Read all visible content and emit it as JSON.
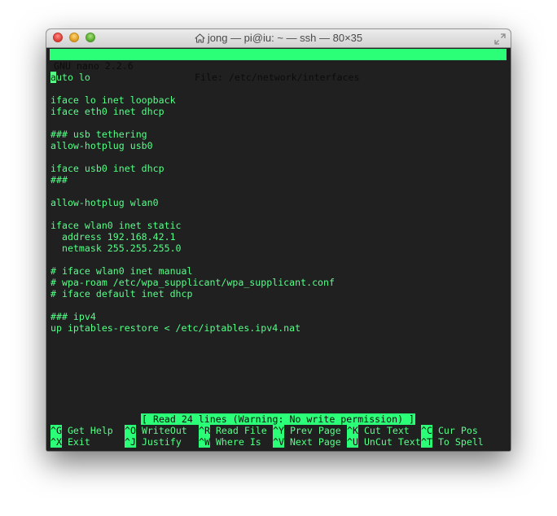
{
  "window": {
    "title": "jong — pi@iu: ~ — ssh — 80×35"
  },
  "nano": {
    "version": "GNU nano 2.2.6",
    "file": "File: /etc/network/interfaces",
    "cursor_char": "a",
    "first_line_rest": "uto lo",
    "lines": [
      "",
      "iface lo inet loopback",
      "iface eth0 inet dhcp",
      "",
      "### usb tethering",
      "allow-hotplug usb0",
      "",
      "iface usb0 inet dhcp",
      "###",
      "",
      "allow-hotplug wlan0",
      "",
      "iface wlan0 inet static",
      "  address 192.168.42.1",
      "  netmask 255.255.255.0",
      "",
      "# iface wlan0 inet manual",
      "# wpa-roam /etc/wpa_supplicant/wpa_supplicant.conf",
      "# iface default inet dhcp",
      "",
      "### ipv4",
      "up iptables-restore < /etc/iptables.ipv4.nat"
    ],
    "status": "[ Read 24 lines (Warning: No write permission) ]",
    "shortcuts_row1": [
      {
        "key": "^G",
        "label": " Get Help"
      },
      {
        "key": "^O",
        "label": " WriteOut"
      },
      {
        "key": "^R",
        "label": " Read File"
      },
      {
        "key": "^Y",
        "label": " Prev Page"
      },
      {
        "key": "^K",
        "label": " Cut Text"
      },
      {
        "key": "^C",
        "label": " Cur Pos"
      }
    ],
    "shortcuts_row2": [
      {
        "key": "^X",
        "label": " Exit"
      },
      {
        "key": "^J",
        "label": " Justify"
      },
      {
        "key": "^W",
        "label": " Where Is"
      },
      {
        "key": "^V",
        "label": " Next Page"
      },
      {
        "key": "^U",
        "label": " UnCut Text"
      },
      {
        "key": "^T",
        "label": " To Spell"
      }
    ]
  },
  "colors": {
    "terminal_bg": "#202020",
    "terminal_fg": "#55ff88",
    "highlight_bg": "#2bff78"
  },
  "icons": {
    "title": "home-icon",
    "corner": "fullscreen-icon"
  }
}
